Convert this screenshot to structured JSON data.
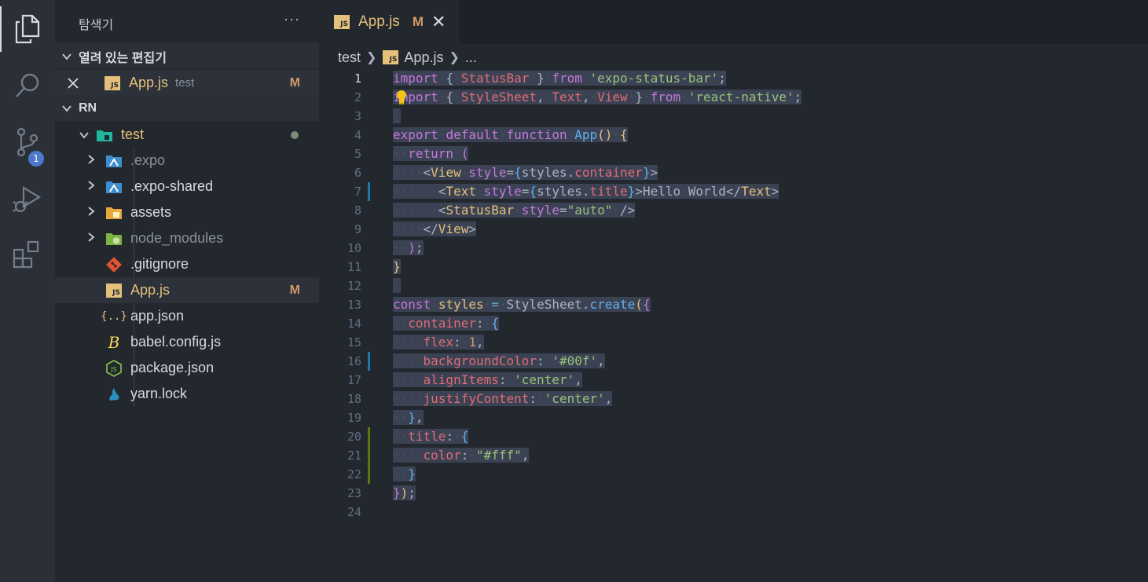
{
  "activity_bar": {
    "items": [
      {
        "name": "explorer-icon",
        "active": true
      },
      {
        "name": "search-icon",
        "active": false
      },
      {
        "name": "source-control-icon",
        "active": false,
        "badge": "1"
      },
      {
        "name": "run-debug-icon",
        "active": false
      },
      {
        "name": "extensions-icon",
        "active": false
      }
    ]
  },
  "sidebar": {
    "title": "탐색기",
    "more": "···",
    "open_editors": {
      "header": "열려 있는 편집기",
      "items": [
        {
          "name": "App.js",
          "folder": "test",
          "status": "M"
        }
      ]
    },
    "workspace": {
      "header": "RN",
      "folder": "test",
      "items": [
        {
          "label": ".expo",
          "icon": "expo-folder-icon",
          "dim": true
        },
        {
          "label": ".expo-shared",
          "icon": "expo-folder-icon",
          "dim": false
        },
        {
          "label": "assets",
          "icon": "assets-folder-icon",
          "dim": false
        },
        {
          "label": "node_modules",
          "icon": "node-folder-icon",
          "dim": true
        },
        {
          "label": ".gitignore",
          "icon": "git-icon",
          "dim": false
        },
        {
          "label": "App.js",
          "icon": "js-icon",
          "status": "M"
        },
        {
          "label": "app.json",
          "icon": "json-icon"
        },
        {
          "label": "babel.config.js",
          "icon": "babel-icon"
        },
        {
          "label": "package.json",
          "icon": "node-icon"
        },
        {
          "label": "yarn.lock",
          "icon": "yarn-icon"
        }
      ]
    }
  },
  "editor": {
    "tab": {
      "label": "App.js",
      "status": "M",
      "close": "✕"
    },
    "breadcrumb": [
      "test",
      "App.js",
      "..."
    ],
    "line_numbers": [
      "1",
      "2",
      "3",
      "4",
      "5",
      "6",
      "7",
      "8",
      "9",
      "10",
      "11",
      "12",
      "13",
      "14",
      "15",
      "16",
      "17",
      "18",
      "19",
      "20",
      "21",
      "22",
      "23",
      "24"
    ],
    "current_line": 1
  },
  "colors": {
    "keyword": "#c678dd",
    "string": "#98c379",
    "variable": "#e06c75",
    "function": "#61afef",
    "number": "#d19a66",
    "accent_modified": "#e5c07b",
    "selection": "#3b4253"
  }
}
